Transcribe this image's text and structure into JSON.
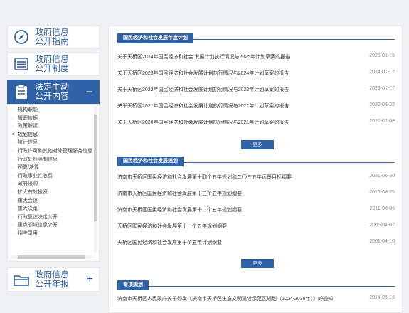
{
  "sidebar": {
    "nav": [
      {
        "line1": "政府信息",
        "line2": "公开指南",
        "icon": "compass-icon"
      },
      {
        "line1": "政府信息",
        "line2": "公开制度",
        "icon": "list-icon"
      },
      {
        "line1": "法定主动",
        "line2": "公开内容",
        "icon": "clipboard-icon",
        "toggle": "−"
      },
      {
        "line1": "政府信息",
        "line2": "公开年报",
        "icon": "folder-icon",
        "toggle": "+"
      }
    ],
    "submenu": [
      "机构职能",
      "履职依据",
      "政策解读",
      "规划信息",
      "统计信息",
      "行政许可和其他对外管理服务信息",
      "行政处罚强制信息",
      "预算/决算",
      "行政事业性收费",
      "政府采购",
      "扩大有效投资",
      "重大会议",
      "重大决策",
      "行政复议决定公开",
      "重点领域信息公开",
      "招考录用"
    ]
  },
  "sections": [
    {
      "title": "国民经济和社会发展年度计划",
      "rows": [
        {
          "title": "关于天桥区2024年国民经济和社会 发展计划执行情况与2025年计划草案的报告",
          "date": "2025-01-15"
        },
        {
          "title": "关于天桥区2023年国民经济和社会发展计划执行情况与2024年计划草案的报告",
          "date": "2024-01-17"
        },
        {
          "title": "关于天桥区2022年国民经济和社会发展计划执行情况与2023年计划草案的报告",
          "date": "2023-01-17"
        },
        {
          "title": "关于天桥区2021年国民经济和社会发展计划执行情况与2022年计划草案的报告",
          "date": "2022-03-22"
        },
        {
          "title": "关于天桥区2020年国民经济和社会发展计划执行情况与2021年计划草案的报告",
          "date": "2021-02-08"
        }
      ],
      "more": "更多"
    },
    {
      "title": "国民经济和社会发展规划",
      "rows": [
        {
          "title": "济南市天桥区国民经济和社会发展第十四个五年规划和二〇三五年远景目标纲要",
          "date": "2021-06-30"
        },
        {
          "title": "济南市天桥区国民经济和社会发展第十三个五年规划纲要",
          "date": "2016-08-25"
        },
        {
          "title": "济南市天桥区国民经济和社会发展第十二个五年规划纲要",
          "date": "2011-08-06"
        },
        {
          "title": "天桥区国民经济和社会发展第十一个五年规划纲要",
          "date": "2006-04-07"
        },
        {
          "title": "天桥区国民经济和社会发展第十个五年计划纲要",
          "date": "2001-04-10"
        }
      ],
      "more": "更多"
    },
    {
      "title": "专项规划",
      "rows": [
        {
          "title": "济南市天桥区人民政府关于印发《济南市天桥区生态文明建设示范区规划（2024-2030年）》的通知",
          "date": "2024-05-16"
        }
      ]
    }
  ]
}
